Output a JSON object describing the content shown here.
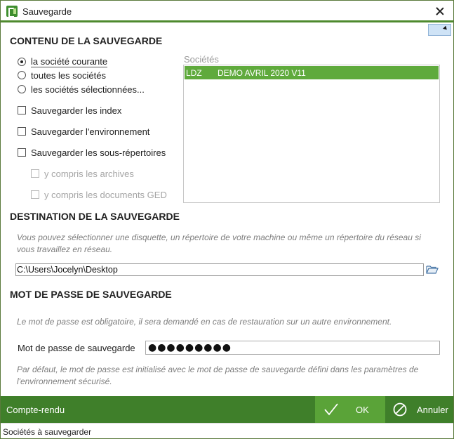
{
  "window": {
    "title": "Sauvegarde"
  },
  "contenu": {
    "title": "CONTENU DE LA SAUVEGARDE",
    "radios": [
      {
        "label": "la société courante",
        "checked": true
      },
      {
        "label": "toutes les sociétés",
        "checked": false
      },
      {
        "label": "les sociétés sélectionnées...",
        "checked": false
      }
    ],
    "checkboxes": [
      {
        "label": "Sauvegarder les index",
        "checked": false,
        "enabled": true
      },
      {
        "label": "Sauvegarder l'environnement",
        "checked": false,
        "enabled": true
      },
      {
        "label": "Sauvegarder les sous-répertoires",
        "checked": false,
        "enabled": true
      },
      {
        "label": "y compris les archives",
        "checked": false,
        "enabled": false
      },
      {
        "label": "y compris les documents GED",
        "checked": false,
        "enabled": false
      }
    ],
    "societes": {
      "label": "Sociétés",
      "rows": [
        {
          "code": "LDZ",
          "name": "DEMO AVRIL 2020 V11",
          "selected": true
        }
      ]
    }
  },
  "destination": {
    "title": "DESTINATION DE LA SAUVEGARDE",
    "info_line1": "Vous pouvez sélectionner une disquette, un répertoire de votre machine ou même un répertoire du réseau si",
    "info_line2": "vous travaillez en réseau.",
    "path": "C:\\Users\\Jocelyn\\Desktop"
  },
  "password": {
    "title": "MOT DE PASSE DE SAUVEGARDE",
    "info": "Le mot de passe est obligatoire, il sera demandé en cas de restauration sur un autre environnement.",
    "label": "Mot de passe de sauvegarde",
    "value": "●●●●●●●●●",
    "default_info_line1": "Par défaut, le mot de passe est initialisé avec le mot de passe de sauvegarde défini dans les paramètres de",
    "default_info_line2": "l'environnement sécurisé."
  },
  "footer": {
    "compte_rendu": "Compte-rendu",
    "ok": "OK",
    "cancel": "Annuler"
  },
  "status": {
    "text": "Sociétés à sauvegarder"
  },
  "colors": {
    "accent": "#3f7f2a",
    "ok": "#5aa338",
    "selection": "#5faa3c"
  }
}
